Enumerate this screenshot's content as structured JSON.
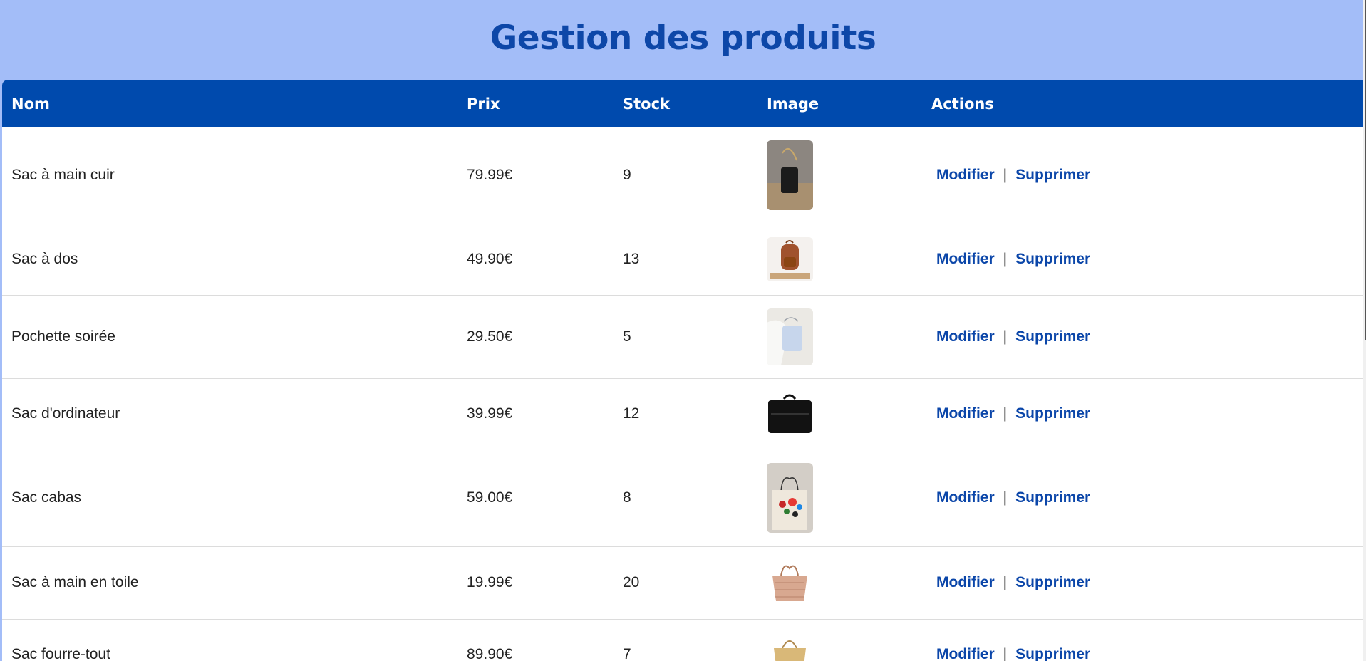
{
  "header": {
    "title": "Gestion des produits"
  },
  "table": {
    "columns": [
      "Nom",
      "Prix",
      "Stock",
      "Image",
      "Actions"
    ],
    "rows": [
      {
        "nom": "Sac à main cuir",
        "prix": "79.99€",
        "stock": "9",
        "image": "leather-handbag-photo",
        "modifier": "Modifier",
        "supprimer": "Supprimer"
      },
      {
        "nom": "Sac à dos",
        "prix": "49.90€",
        "stock": "13",
        "image": "backpack-photo",
        "modifier": "Modifier",
        "supprimer": "Supprimer"
      },
      {
        "nom": "Pochette soirée",
        "prix": "29.50€",
        "stock": "5",
        "image": "evening-clutch-photo",
        "modifier": "Modifier",
        "supprimer": "Supprimer"
      },
      {
        "nom": "Sac d'ordinateur",
        "prix": "39.99€",
        "stock": "12",
        "image": "laptop-bag-photo",
        "modifier": "Modifier",
        "supprimer": "Supprimer"
      },
      {
        "nom": "Sac cabas",
        "prix": "59.00€",
        "stock": "8",
        "image": "tote-bag-photo",
        "modifier": "Modifier",
        "supprimer": "Supprimer"
      },
      {
        "nom": "Sac à main en toile",
        "prix": "19.99€",
        "stock": "20",
        "image": "canvas-handbag-photo",
        "modifier": "Modifier",
        "supprimer": "Supprimer"
      },
      {
        "nom": "Sac fourre-tout",
        "prix": "89.90€",
        "stock": "7",
        "image": "carryall-bag-photo",
        "modifier": "Modifier",
        "supprimer": "Supprimer"
      }
    ],
    "separator": "|"
  },
  "colors": {
    "background": "#a3bdf8",
    "header_bg": "#004aad",
    "title": "#0d47a8",
    "link": "#0b46a9"
  }
}
